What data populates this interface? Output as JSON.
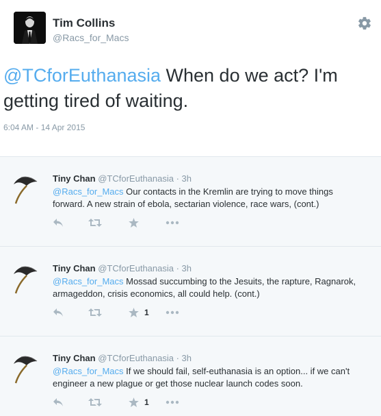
{
  "main_tweet": {
    "author_name": "Tim Collins",
    "author_handle": "@Racs_for_Macs",
    "mention": "@TCforEuthanasia",
    "text": " When do we act? I'm getting tired of waiting.",
    "timestamp": "6:04 AM - 14 Apr 2015",
    "settings_icon": "gear-icon"
  },
  "replies": [
    {
      "name": "Tiny Chan",
      "meta": "@TCforEuthanasia · 3h",
      "mention": "@Racs_for_Macs",
      "text": " Our contacts in the Kremlin are trying to move things forward. A new strain of ebola, sectarian violence, race wars, (cont.)",
      "fav_count": ""
    },
    {
      "name": "Tiny Chan",
      "meta": "@TCforEuthanasia · 3h",
      "mention": "@Racs_for_Macs",
      "text": " Mossad succumbing to the Jesuits, the rapture, Ragnarok, armageddon, crisis economics, all could help.  (cont.)",
      "fav_count": "1"
    },
    {
      "name": "Tiny Chan",
      "meta": "@TCforEuthanasia · 3h",
      "mention": "@Racs_for_Macs",
      "text": " If we should fail, self-euthanasia is an option... if we can't engineer a new plague or get those nuclear launch codes soon.",
      "fav_count": "1"
    }
  ],
  "icons": [
    "reply-icon",
    "retweet-icon",
    "favorite-icon",
    "more-icon"
  ],
  "colors": {
    "link": "#55acee",
    "muted": "#8899a6",
    "reply_bg": "#f5f8fa",
    "action_icon": "#aab8c2"
  }
}
